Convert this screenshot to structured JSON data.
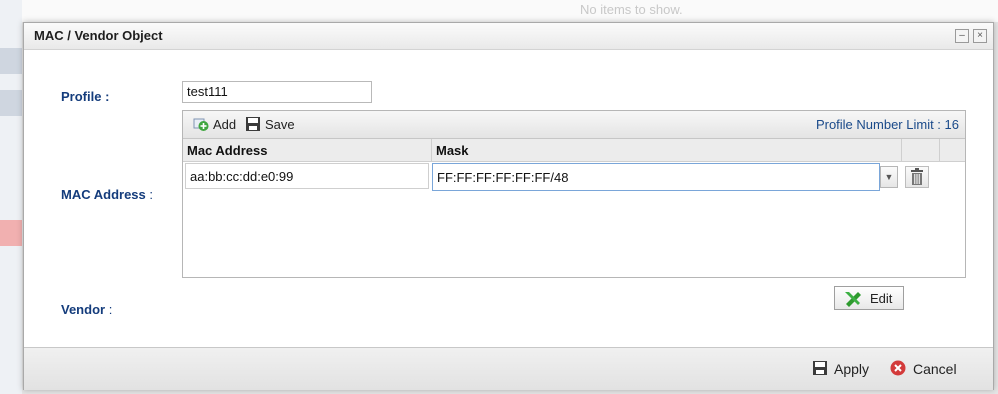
{
  "background": {
    "no_items_text": "No items to show."
  },
  "dialog": {
    "title": "MAC / Vendor Object",
    "profile_label": "Profile :",
    "profile_value": "test111",
    "mac_label": "MAC Address",
    "mac_colon": ":",
    "vendor_label": "Vendor",
    "vendor_colon": ":",
    "toolbar": {
      "add_label": "Add",
      "save_label": "Save",
      "limit_text": "Profile Number Limit : 16"
    },
    "columns": [
      "Mac Address",
      "Mask"
    ],
    "rows": [
      {
        "mac": "aa:bb:cc:dd:e0:99",
        "mask": "FF:FF:FF:FF:FF:FF/48"
      }
    ],
    "edit_label": "Edit",
    "footer": {
      "apply_label": "Apply",
      "cancel_label": "Cancel"
    }
  },
  "colors": {
    "label_blue": "#143c7c",
    "add_icon_green": "#3fa63f",
    "cancel_icon_red": "#d33a3a",
    "edit_icon_green": "#2e9a2e"
  }
}
